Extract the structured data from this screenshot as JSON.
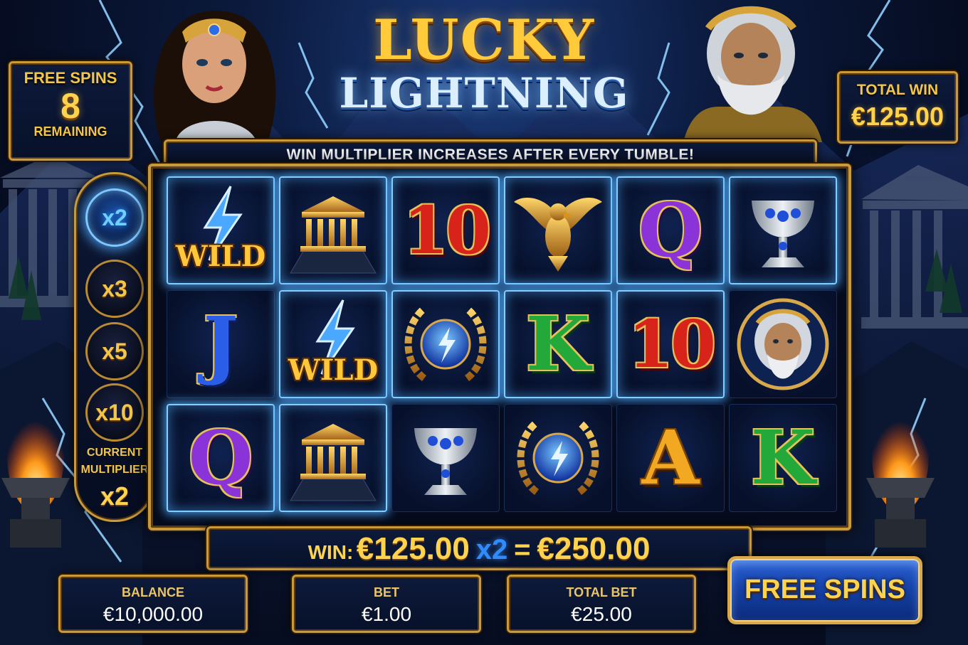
{
  "game": {
    "title_line1": "LUCKY",
    "title_line2": "LIGHTNING"
  },
  "free_spins": {
    "label": "FREE SPINS",
    "count": "8",
    "remaining_label": "REMAINING"
  },
  "total_win": {
    "label": "TOTAL WIN",
    "value": "€125.00"
  },
  "banner": {
    "text": "WIN MULTIPLIER INCREASES AFTER EVERY TUMBLE!"
  },
  "multiplier": {
    "steps": [
      "x2",
      "x3",
      "x5",
      "x10"
    ],
    "active_index": 0,
    "current_label": "CURRENT MULTIPLIER",
    "current_value": "x2"
  },
  "reels": {
    "rows": [
      [
        {
          "symbol": "wild",
          "label": "WILD",
          "highlighted": true
        },
        {
          "symbol": "temple-icon",
          "highlighted": true
        },
        {
          "symbol": "ten",
          "label": "10",
          "highlighted": true
        },
        {
          "symbol": "eagle-icon",
          "highlighted": true
        },
        {
          "symbol": "q",
          "label": "Q",
          "highlighted": true
        },
        {
          "symbol": "chalice-icon",
          "highlighted": true
        }
      ],
      [
        {
          "symbol": "j",
          "label": "J",
          "highlighted": false
        },
        {
          "symbol": "wild",
          "label": "WILD",
          "highlighted": true
        },
        {
          "symbol": "laurel-icon",
          "highlighted": true
        },
        {
          "symbol": "k",
          "label": "K",
          "highlighted": true
        },
        {
          "symbol": "ten",
          "label": "10",
          "highlighted": true
        },
        {
          "symbol": "zeus-icon",
          "highlighted": false
        }
      ],
      [
        {
          "symbol": "q",
          "label": "Q",
          "highlighted": true
        },
        {
          "symbol": "temple-icon",
          "highlighted": true
        },
        {
          "symbol": "chalice-icon",
          "highlighted": false
        },
        {
          "symbol": "laurel-icon",
          "highlighted": false
        },
        {
          "symbol": "a",
          "label": "A",
          "highlighted": false
        },
        {
          "symbol": "k",
          "label": "K",
          "highlighted": false
        }
      ]
    ]
  },
  "win": {
    "label": "WIN:",
    "amount": "€125.00",
    "multiplier": "x2",
    "equals": "=",
    "total": "€250.00"
  },
  "footer": {
    "balance_label": "BALANCE",
    "balance_value": "€10,000.00",
    "bet_label": "BET",
    "bet_value": "€1.00",
    "total_bet_label": "TOTAL BET",
    "total_bet_value": "€25.00",
    "free_spins_button": "FREE SPINS"
  },
  "colors": {
    "gold": "#c99a3c",
    "gold_text": "#ffd34d",
    "lightning_blue": "#7fd0ff",
    "background_dark": "#050c1e"
  }
}
